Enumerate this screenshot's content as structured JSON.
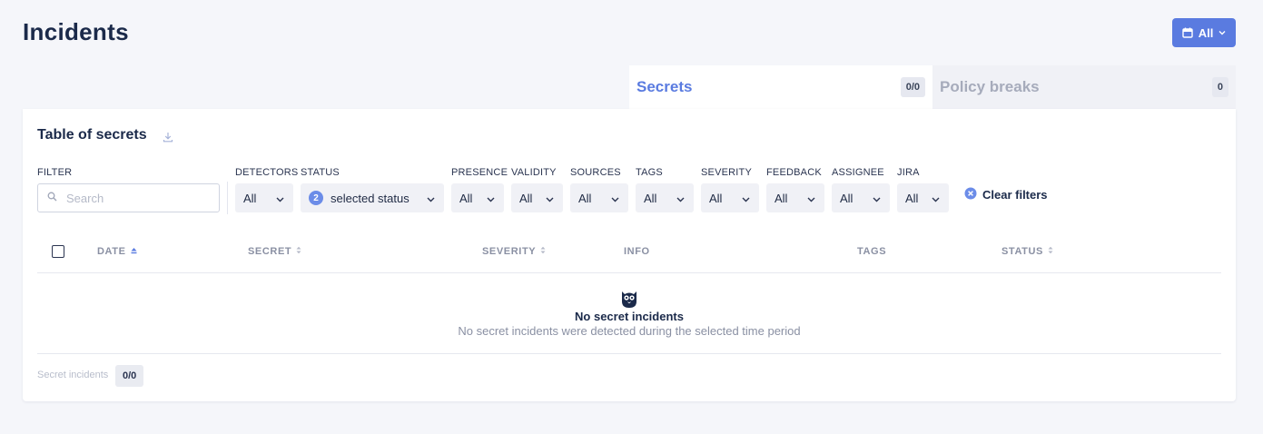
{
  "page": {
    "title": "Incidents"
  },
  "date_filter": {
    "label": "All",
    "icon": "calendar-icon"
  },
  "tabs": [
    {
      "label": "Secrets",
      "badge": "0/0",
      "active": true
    },
    {
      "label": "Policy breaks",
      "badge": "0",
      "active": false
    }
  ],
  "table": {
    "title": "Table of secrets",
    "download_icon": "download-icon"
  },
  "filters": {
    "filter_label": "FILTER",
    "search_placeholder": "Search",
    "search_value": "",
    "detectors": {
      "label": "DETECTORS",
      "value": "All"
    },
    "status": {
      "label": "STATUS",
      "count": "2",
      "value": "selected status"
    },
    "presence": {
      "label": "PRESENCE",
      "value": "All"
    },
    "validity": {
      "label": "VALIDITY",
      "value": "All"
    },
    "sources": {
      "label": "SOURCES",
      "value": "All"
    },
    "tags": {
      "label": "TAGS",
      "value": "All"
    },
    "severity": {
      "label": "SEVERITY",
      "value": "All"
    },
    "feedback": {
      "label": "FEEDBACK",
      "value": "All"
    },
    "assignee": {
      "label": "ASSIGNEE",
      "value": "All"
    },
    "jira": {
      "label": "JIRA",
      "value": "All"
    },
    "clear_label": "Clear filters"
  },
  "columns": {
    "date": "DATE",
    "secret": "SECRET",
    "severity": "SEVERITY",
    "info": "INFO",
    "tags": "TAGS",
    "status": "STATUS"
  },
  "empty_state": {
    "icon": "owl-icon",
    "title": "No secret incidents",
    "description": "No secret incidents were detected during the selected time period"
  },
  "footer": {
    "label": "Secret incidents",
    "count": "0/0"
  },
  "colors": {
    "accent": "#5a7be0",
    "background": "#f5f6fa",
    "title": "#1b2a4a",
    "muted": "#8a90a3"
  }
}
